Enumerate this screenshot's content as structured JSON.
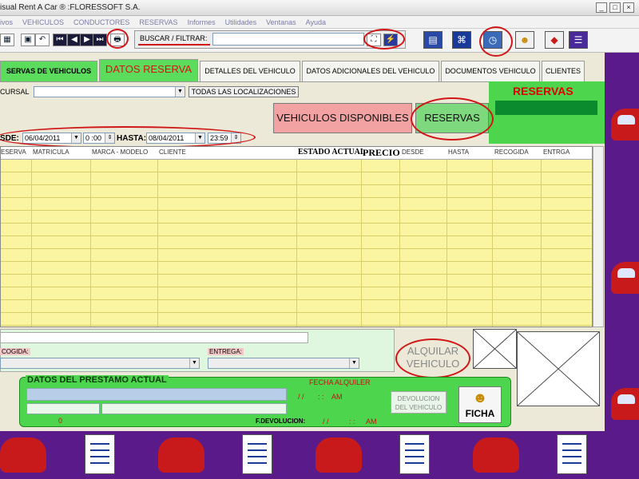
{
  "window": {
    "title": "isual Rent A Car ® :FLORESSOFT S.A.",
    "controls": [
      "_",
      "□",
      "×"
    ]
  },
  "menu": [
    "ivos",
    "VEHICULOS",
    "CONDUCTORES",
    "RESERVAS",
    "Informes",
    "Utilidades",
    "Ventanas",
    "Ayuda"
  ],
  "toolbar": {
    "search_label": "BUSCAR / FILTRAR:",
    "search_value": "",
    "nav_first": "⏮",
    "nav_prev": "◀",
    "nav_next": "▶",
    "nav_last": "⏭",
    "print": "🖶"
  },
  "tabs": [
    {
      "label": "SERVAS DE VEHICULOS"
    },
    {
      "label": "DATOS RESERVA"
    },
    {
      "label": "DETALLES DEL VEHICULO"
    },
    {
      "label": "DATOS ADICIONALES DEL VEHICULO"
    },
    {
      "label": "DOCUMENTOS VEHICULO"
    },
    {
      "label": "CLIENTES"
    }
  ],
  "filters": {
    "sucursal_label": "CURSAL",
    "sucursal_value": "",
    "todas_button": "TODAS LAS LOCALIZACIONES",
    "desde_label": "SDE:",
    "desde_date": "06/04/2011",
    "desde_time": "0 :00",
    "hasta_label": "HASTA:",
    "hasta_date": "08/04/2011",
    "hasta_time": "23:59"
  },
  "buttons": {
    "vehiculos_disponibles": "VEHICULOS DISPONIBLES",
    "reservas": "RESERVAS",
    "alquilar_line1": "ALQUILAR",
    "alquilar_line2": "VEHICULO",
    "devolucion_line1": "DEVOLUCION",
    "devolucion_line2": "DEL VEHICULO",
    "ficha": "FICHA"
  },
  "reservas_panel": {
    "title": "RESERVAS"
  },
  "grid": {
    "columns": [
      "ESERVA",
      "MATRICULA",
      "MARCA - MODELO",
      "CLIENTE",
      "ESTADO ACTUAL",
      "PRECIO",
      "DESDE",
      "HASTA",
      "RECOGIDA",
      "ENTRGA"
    ]
  },
  "bottom": {
    "recogida_label": "COGIDA:",
    "entrega_label": "ENTREGA:",
    "alquilar_counter": "0"
  },
  "prestamo": {
    "title": "DATOS DEL PRESTAMO ACTUAL",
    "fecha_alquiler_label": "FECHA ALQUILER",
    "fecha_alquiler_value": "/ /",
    "fecha_alquiler_time": ": :",
    "fecha_alquiler_ampm": "AM",
    "f_devolucion_label": "F.DEVOLUCION:",
    "f_devolucion_value": "/ /",
    "f_devolucion_time": ": :",
    "f_devolucion_ampm": "AM",
    "counter": "0"
  },
  "colors": {
    "accent_green": "#4dd54d",
    "highlight_red": "#d01616",
    "grid_yellow": "#fbf4a0",
    "side_purple": "#5b1a8a"
  }
}
